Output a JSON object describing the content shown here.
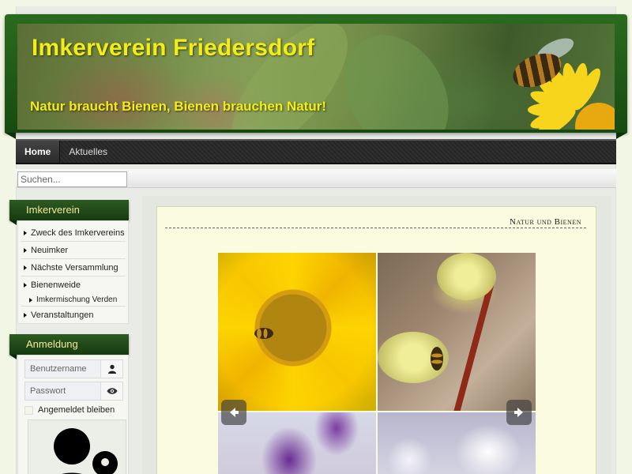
{
  "header": {
    "title": "Imkerverein Friedersdorf",
    "slogan": "Natur braucht Bienen, Bienen brauchen Natur!"
  },
  "nav": {
    "items": [
      {
        "label": "Home",
        "active": true
      },
      {
        "label": "Aktuelles",
        "active": false
      }
    ]
  },
  "search": {
    "placeholder": "Suchen..."
  },
  "sidebar": {
    "menu_title": "Imkerverein",
    "menu_items": [
      {
        "label": "Zweck des Imkervereins"
      },
      {
        "label": "Neuimker"
      },
      {
        "label": "Nächste Versammlung"
      },
      {
        "label": "Bienenweide"
      },
      {
        "label": "Imkermischung Verden",
        "sub": true
      },
      {
        "label": "Veranstaltungen"
      }
    ],
    "login_title": "Anmeldung",
    "username_placeholder": "Benutzername",
    "password_placeholder": "Passwort",
    "remember_label": "Angemeldet bleiben"
  },
  "article": {
    "heading": "Natur und Bienen"
  },
  "gallery": {
    "images": [
      "sunflower-with-bee",
      "willow-catkins-with-bee",
      "purple-crocus",
      "white-crocus"
    ]
  },
  "icons": {
    "user": "user-icon",
    "eye": "eye-icon",
    "prev": "arrow-left-icon",
    "next": "arrow-right-icon"
  },
  "colors": {
    "title_yellow": "#f5ec14",
    "header_green": "#1f5416",
    "page_background": "#f2f6e4",
    "content_background": "#fbfbe0",
    "module_title_text": "#f3ea9e"
  }
}
